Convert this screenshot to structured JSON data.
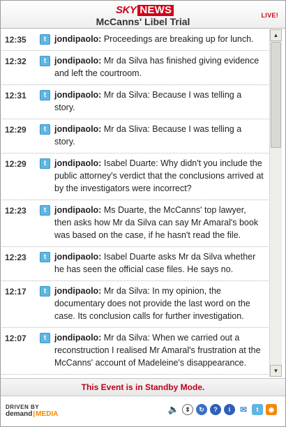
{
  "header": {
    "logo_sky": "SKY",
    "logo_news": "NEWS",
    "title": "McCanns' Libel Trial",
    "live_badge": "LIVE!"
  },
  "entries": [
    {
      "time": "12:35",
      "author": "jondipaolo:",
      "text": "Proceedings are breaking up for lunch."
    },
    {
      "time": "12:32",
      "author": "jondipaolo:",
      "text": "Mr da Silva has finished giving evidence and left the courtroom."
    },
    {
      "time": "12:31",
      "author": "jondipaolo:",
      "text": "Mr da Silva: Because I was telling a story."
    },
    {
      "time": "12:29",
      "author": "jondipaolo:",
      "text": "Mr da Sliva: Because I was telling a story."
    },
    {
      "time": "12:29",
      "author": "jondipaolo:",
      "text": "Isabel Duarte: Why didn't you include the public attorney's verdict that the conclusions arrived at by the investigators were incorrect?"
    },
    {
      "time": "12:23",
      "author": "jondipaolo:",
      "text": "Ms Duarte, the McCanns' top lawyer, then asks how Mr da Silva can say Mr Amaral's book was based on the case, if he hasn't read the file."
    },
    {
      "time": "12:23",
      "author": "jondipaolo:",
      "text": "Isabel Duarte asks Mr da Silva whether he has seen the official case files. He says no."
    },
    {
      "time": "12:17",
      "author": "jondipaolo:",
      "text": "Mr da Silva: In my opinion, the documentary does not provide the last word on the case. Its conclusion calls for further investigation."
    },
    {
      "time": "12:07",
      "author": "jondipaolo:",
      "text": "Mr da Silva: When we carried out a reconstruction I realised Mr Amaral's frustration at the McCanns' account of Madeleine's disappearance."
    }
  ],
  "status": {
    "message": "This Event is in Standby Mode."
  },
  "footer": {
    "driven_by": "DRIVEN BY",
    "brand_demand": "demand",
    "brand_sep": "|",
    "brand_media": "MEDIA"
  },
  "colors": {
    "brand_red": "#d0021b",
    "status_red": "#c0001a",
    "media_orange": "#f08a00",
    "twitter_blue": "#5fb6e4"
  },
  "icons": [
    "speaker-icon",
    "drag-icon",
    "refresh-icon",
    "help-icon",
    "info-icon",
    "chat-icon",
    "twitter-icon",
    "rss-icon"
  ]
}
